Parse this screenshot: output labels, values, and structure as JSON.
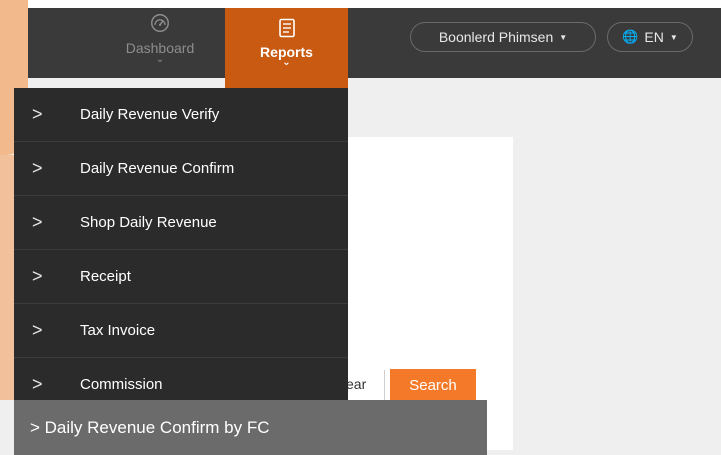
{
  "nav": {
    "dashboard_label": "Dashboard",
    "reports_label": "Reports",
    "chevron": "⌄"
  },
  "header": {
    "user_name": "Boonlerd Phimsen",
    "language": "EN"
  },
  "menu": {
    "items": [
      {
        "label": "Daily Revenue Verify"
      },
      {
        "label": "Daily Revenue Confirm"
      },
      {
        "label": "Shop Daily Revenue"
      },
      {
        "label": "Receipt"
      },
      {
        "label": "Tax Invoice"
      },
      {
        "label": "Commission"
      }
    ]
  },
  "form": {
    "clear_label": "ear",
    "search_label": "Search"
  },
  "tooltip": {
    "text": "> Daily Revenue Confirm by FC"
  },
  "colors": {
    "topbar": "#3a3a3a",
    "reports_active": "#c85a12",
    "search_button": "#f47a2a",
    "menu_bg": "#2b2b2b",
    "tooltip_bg": "#6b6b6b"
  },
  "icons": {
    "dashboard": "speedometer-icon",
    "reports": "notebook-icon",
    "chevron": "chevron-right-icon",
    "caret": "caret-down-icon",
    "globe": "globe-icon"
  }
}
